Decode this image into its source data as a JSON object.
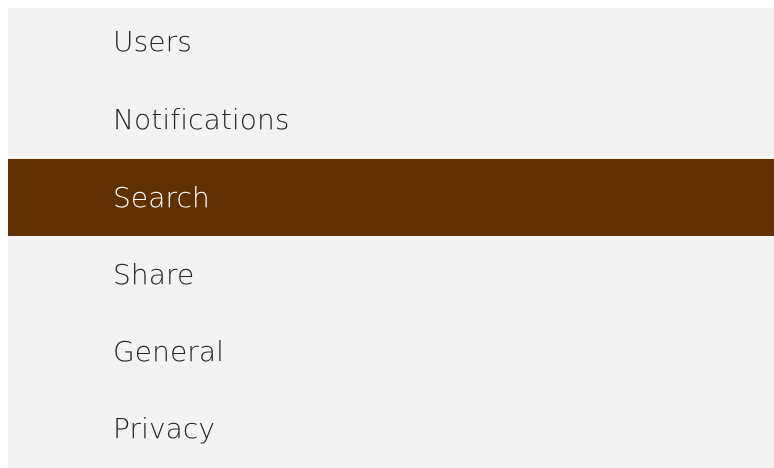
{
  "settings_menu": {
    "items": [
      {
        "label": "Users",
        "selected": false
      },
      {
        "label": "Notifications",
        "selected": false
      },
      {
        "label": "Search",
        "selected": true
      },
      {
        "label": "Share",
        "selected": false
      },
      {
        "label": "General",
        "selected": false
      },
      {
        "label": "Privacy",
        "selected": false
      }
    ],
    "colors": {
      "panel_background": "#f3f3f3",
      "selected_background": "#622f00",
      "selected_text": "#ffffff",
      "text": "#262626"
    }
  }
}
